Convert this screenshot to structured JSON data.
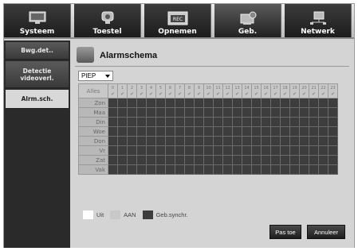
{
  "top_tabs": [
    {
      "label": "Systeem",
      "icon": "monitor-icon",
      "active": false
    },
    {
      "label": "Toestel",
      "icon": "camera-icon",
      "active": false
    },
    {
      "label": "Opnemen",
      "icon": "rec-icon",
      "active": false
    },
    {
      "label": "Geb.",
      "icon": "event-icon",
      "active": true
    },
    {
      "label": "Netwerk",
      "icon": "network-icon",
      "active": false
    }
  ],
  "sidebar": {
    "items": [
      {
        "label": "Bwg.det..",
        "active": false
      },
      {
        "label": "Detectie\nvideoverl.",
        "active": false
      },
      {
        "label": "Alrm.sch.",
        "active": true
      }
    ]
  },
  "main": {
    "title": "Alarmschema",
    "title_icon": "alarm-schedule-icon",
    "select_value": "PIEP",
    "corner_label": "Alles",
    "hours": [
      "0",
      "1",
      "2",
      "3",
      "4",
      "5",
      "6",
      "7",
      "8",
      "9",
      "10",
      "11",
      "12",
      "13",
      "14",
      "15",
      "16",
      "17",
      "18",
      "19",
      "20",
      "21",
      "22",
      "23"
    ],
    "days": [
      "Zon",
      "Maa",
      "Din",
      "Woe",
      "Don",
      "Vr",
      "Zat",
      "Vak"
    ],
    "legend": [
      {
        "label": "Uit",
        "color": "#ffffff"
      },
      {
        "label": "AAN",
        "color": "#c8c8c8"
      },
      {
        "label": "Geb.synchr.",
        "color": "#3d3d3d"
      }
    ],
    "apply_label": "Pas toe",
    "cancel_label": "Annuleer"
  },
  "colors": {
    "grid_event_sync": "#3d3d3d",
    "sidebar_bg": "#2a2a2a",
    "tab_bg": "#1c1c1c"
  }
}
